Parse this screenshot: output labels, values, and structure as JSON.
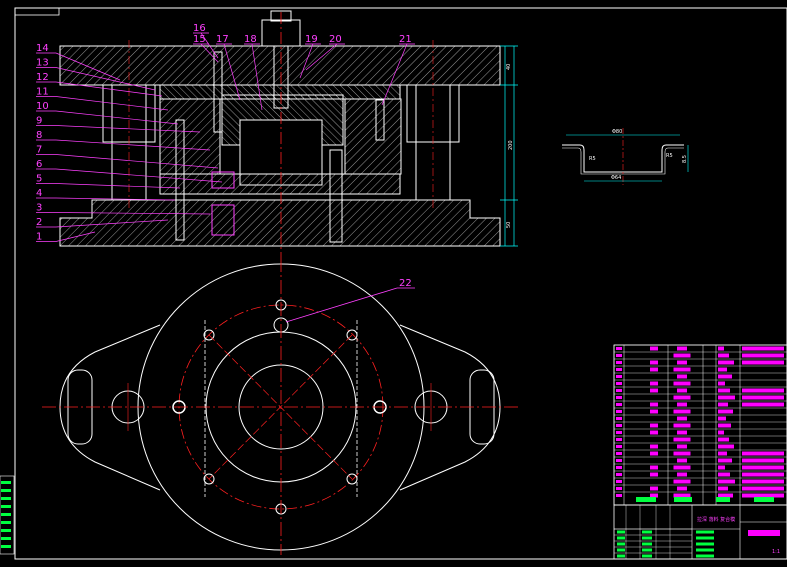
{
  "callouts_left": [
    "14",
    "13",
    "12",
    "11",
    "10",
    "9",
    "8",
    "7",
    "6",
    "5",
    "4",
    "3",
    "2",
    "1"
  ],
  "callouts_top": [
    "16",
    "15",
    "17",
    "18",
    "19",
    "20",
    "21"
  ],
  "callout_plan": "22",
  "section_dims": {
    "upper": "40",
    "total": "200",
    "lower": "50"
  },
  "part_dims": {
    "top_width": "Φ80",
    "bottom_width": "Φ64",
    "left_radius": "R5",
    "right_radius": "R5",
    "height": "8.5"
  },
  "title_block": {
    "drawing_title": "拉深 落料 复合模",
    "scale_note": "1:1"
  },
  "colors": {
    "background": "#000000",
    "outline": "#ffffff",
    "centerline": "#ff2020",
    "callout": "#ff40ff",
    "dimension": "#00ffff",
    "titleblock_fill": "#ff00ff",
    "titleblock_green": "#00ff40"
  }
}
